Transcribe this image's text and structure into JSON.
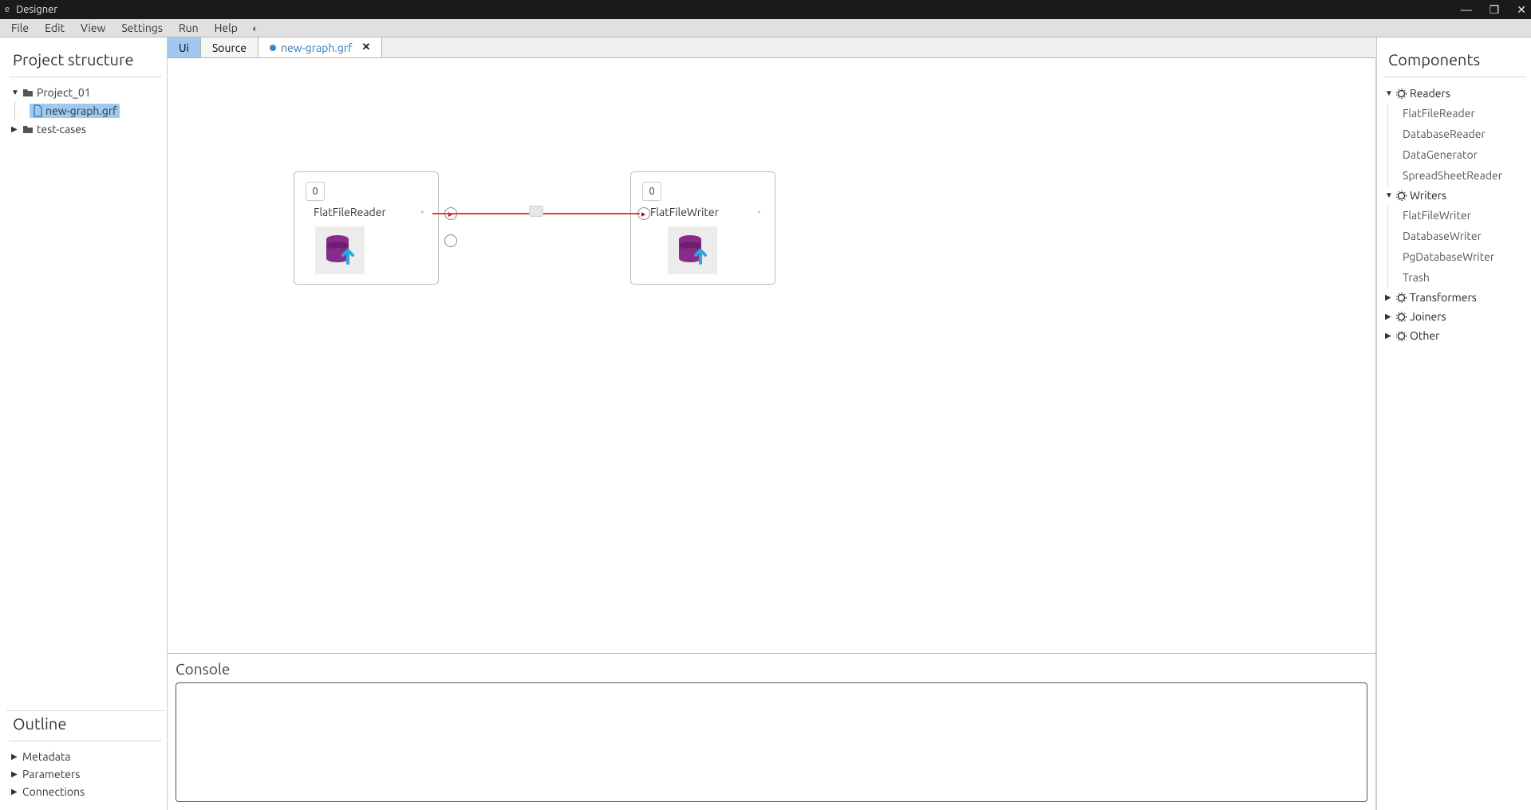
{
  "titlebar": {
    "app_name": "Designer",
    "logo_letter": "e"
  },
  "menubar": {
    "items": [
      "File",
      "Edit",
      "View",
      "Settings",
      "Run",
      "Help"
    ]
  },
  "left_panel": {
    "project_title": "Project structure",
    "tree": {
      "root": {
        "name": "Project_01",
        "expanded": true
      },
      "file": {
        "name": "new-graph.grf",
        "selected": true
      },
      "folder2": {
        "name": "test-cases",
        "expanded": false
      }
    },
    "outline_title": "Outline",
    "outline_items": [
      "Metadata",
      "Parameters",
      "Connections"
    ]
  },
  "tabs": {
    "ui": "Ui",
    "source": "Source",
    "file_tab": "new-graph.grf"
  },
  "canvas": {
    "node_reader": {
      "badge": "0",
      "label": "FlatFileReader"
    },
    "node_writer": {
      "badge": "0",
      "label": "FlatFileWriter"
    },
    "edge_label": ""
  },
  "console": {
    "title": "Console",
    "content": ""
  },
  "right_panel": {
    "title": "Components",
    "readers": {
      "head": "Readers",
      "items": [
        "FlatFileReader",
        "DatabaseReader",
        "DataGenerator",
        "SpreadSheetReader"
      ]
    },
    "writers": {
      "head": "Writers",
      "items": [
        "FlatFileWriter",
        "DatabaseWriter",
        "PgDatabaseWriter",
        "Trash"
      ]
    },
    "transformers": {
      "head": "Transformers"
    },
    "joiners": {
      "head": "Joiners"
    },
    "other": {
      "head": "Other"
    }
  }
}
